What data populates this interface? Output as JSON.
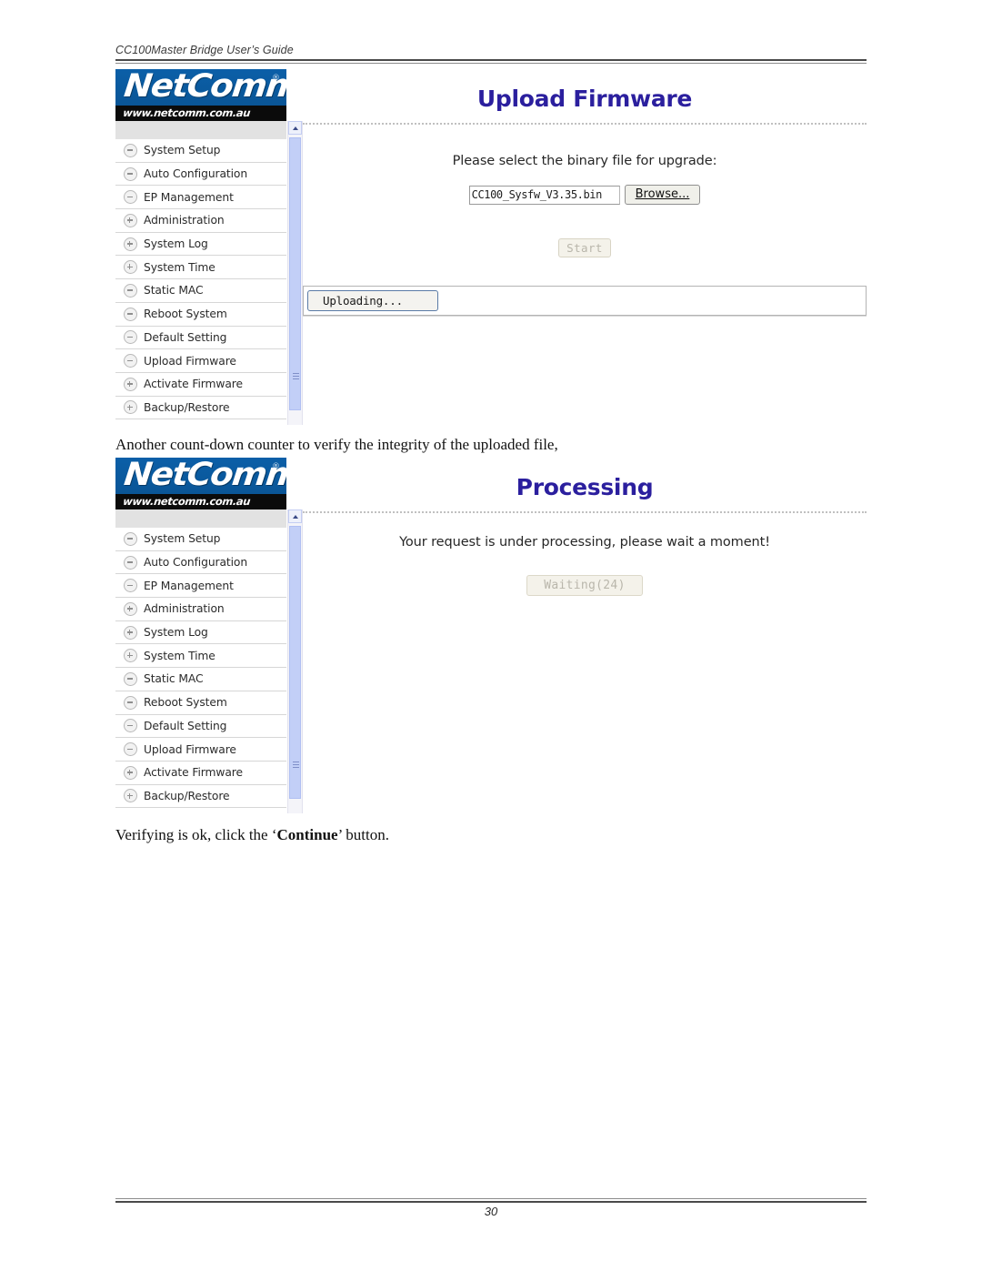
{
  "document": {
    "running_header": "CC100Master Bridge User’s Guide",
    "page_number": "30"
  },
  "brand": {
    "name": "NetComm",
    "registered_mark": "®",
    "url": "www.netcomm.com.au",
    "blue": "#0a5ba0",
    "black": "#0b0b0b",
    "title_color": "#2b1f9e"
  },
  "sidebar": {
    "items": [
      {
        "label": "System Setup",
        "state": "minus"
      },
      {
        "label": "Auto Configuration",
        "state": "minus"
      },
      {
        "label": "EP Management",
        "state": "minus"
      },
      {
        "label": "Administration",
        "state": "plus"
      },
      {
        "label": "System Log",
        "state": "plus"
      },
      {
        "label": "System Time",
        "state": "plus"
      },
      {
        "label": "Static MAC",
        "state": "minus"
      },
      {
        "label": "Reboot System",
        "state": "minus"
      },
      {
        "label": "Default Setting",
        "state": "minus"
      },
      {
        "label": "Upload Firmware",
        "state": "minus"
      },
      {
        "label": "Activate Firmware",
        "state": "plus"
      },
      {
        "label": "Backup/Restore",
        "state": "plus"
      }
    ]
  },
  "screen_upload": {
    "title": "Upload Firmware",
    "instruction": "Please select the binary file for upgrade:",
    "file_value": "CC100_Sysfw_V3.35.bin",
    "file_placeholder": "",
    "browse_label": "Browse...",
    "start_label": "Start",
    "progress_label": "Uploading..."
  },
  "screen_processing": {
    "title": "Processing",
    "message": "Your request is under processing, please wait a moment!",
    "waiting_label": "Waiting(24)"
  },
  "captions": {
    "before_processing": "Another count-down counter to verify the integrity of the uploaded file,",
    "after_processing_prefix": "Verifying is ok, click the ‘",
    "after_processing_strong": "Continue",
    "after_processing_suffix": "’ button."
  }
}
